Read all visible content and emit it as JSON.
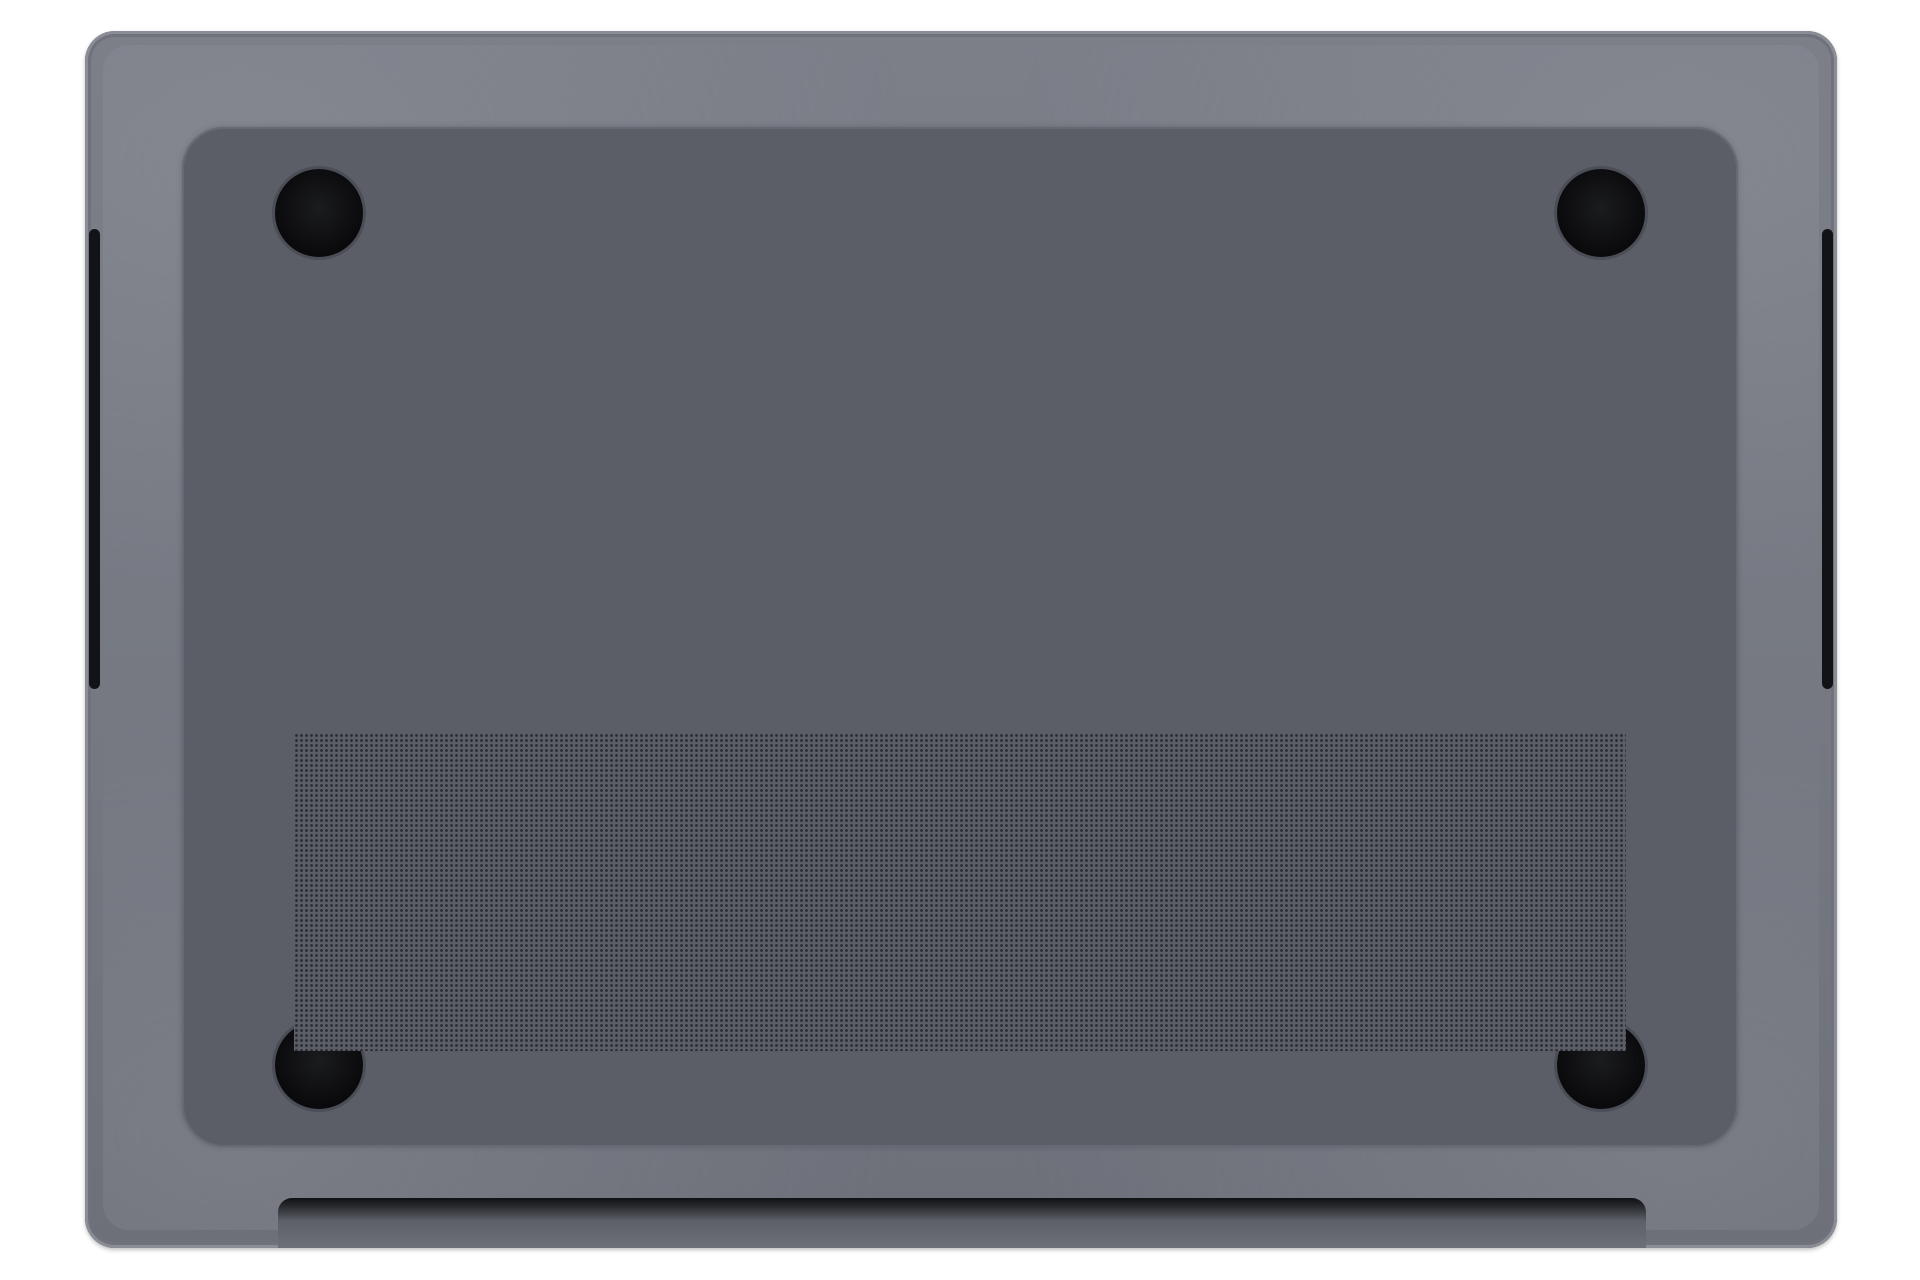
{
  "image": {
    "subject": "laptop-underside",
    "colors": {
      "background": "#ffffff",
      "shell": "#767982",
      "plate": "#5b5e67",
      "feet": "#0b0b0d",
      "grille_holes": "#2e3036"
    },
    "feet_count": 4
  }
}
